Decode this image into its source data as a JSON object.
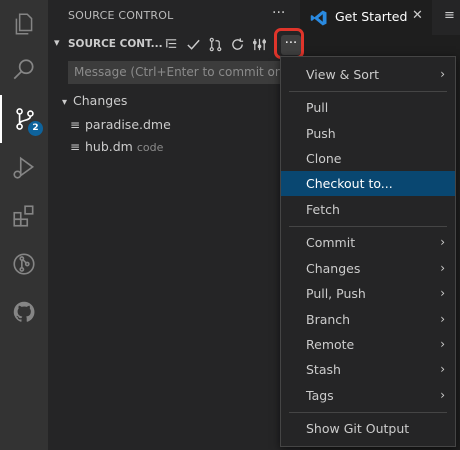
{
  "activity_bar": {
    "items": [
      {
        "icon": "files-icon"
      },
      {
        "icon": "search-icon"
      },
      {
        "icon": "source-control-icon",
        "badge": "2"
      },
      {
        "icon": "run-debug-icon"
      },
      {
        "icon": "extensions-icon"
      },
      {
        "icon": "git-graph-icon"
      },
      {
        "icon": "github-icon"
      }
    ]
  },
  "sidebar": {
    "title": "SOURCE CONTROL",
    "more": "···",
    "section_title": "SOURCE CONT...",
    "message_placeholder": "Message (Ctrl+Enter to commit on '...",
    "changes_label": "Changes",
    "files": [
      {
        "name": "paradise.dme",
        "dir": ""
      },
      {
        "name": "hub.dm",
        "dir": "code"
      }
    ]
  },
  "tabs": {
    "active": "Get Started",
    "close": "✕",
    "overflow": "≡"
  },
  "more_actions": "···",
  "menu": {
    "items": [
      {
        "label": "View & Sort",
        "submenu": true
      },
      {
        "label": "Pull",
        "submenu": false
      },
      {
        "label": "Push",
        "submenu": false
      },
      {
        "label": "Clone",
        "submenu": false
      },
      {
        "label": "Checkout to...",
        "submenu": false,
        "selected": true
      },
      {
        "label": "Fetch",
        "submenu": false
      },
      {
        "label": "Commit",
        "submenu": true
      },
      {
        "label": "Changes",
        "submenu": true
      },
      {
        "label": "Pull, Push",
        "submenu": true
      },
      {
        "label": "Branch",
        "submenu": true
      },
      {
        "label": "Remote",
        "submenu": true
      },
      {
        "label": "Stash",
        "submenu": true
      },
      {
        "label": "Tags",
        "submenu": true
      },
      {
        "label": "Show Git Output",
        "submenu": false
      }
    ],
    "arrow": "›"
  },
  "colors": {
    "accent": "#0e639c",
    "selection": "#094771",
    "highlight_ring": "#e0352b"
  }
}
